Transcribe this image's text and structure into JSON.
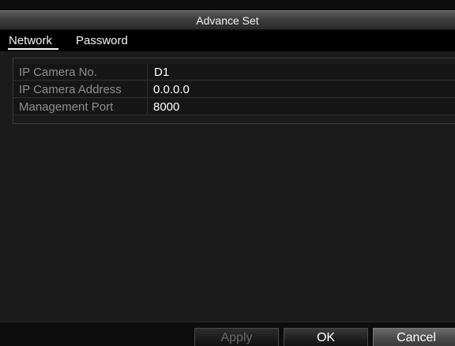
{
  "dialog": {
    "title": "Advance Set"
  },
  "tabs": [
    {
      "label": "Network",
      "active": true
    },
    {
      "label": "Password",
      "active": false
    }
  ],
  "form": {
    "rows": [
      {
        "label": "IP Camera No.",
        "value": "D1"
      },
      {
        "label": "IP Camera Address",
        "value": "0.0.0.0"
      },
      {
        "label": "Management Port",
        "value": "8000"
      }
    ]
  },
  "buttons": {
    "apply": {
      "label": "Apply",
      "enabled": false
    },
    "ok": {
      "label": "OK",
      "enabled": true
    },
    "cancel": {
      "label": "Cancel",
      "enabled": true
    }
  },
  "colors": {
    "background": "#0c0c0c",
    "panel": "#1b1b1b",
    "label_text": "#8f8f8f",
    "value_text": "#ffffff",
    "disabled_text": "#6a6a6a"
  }
}
